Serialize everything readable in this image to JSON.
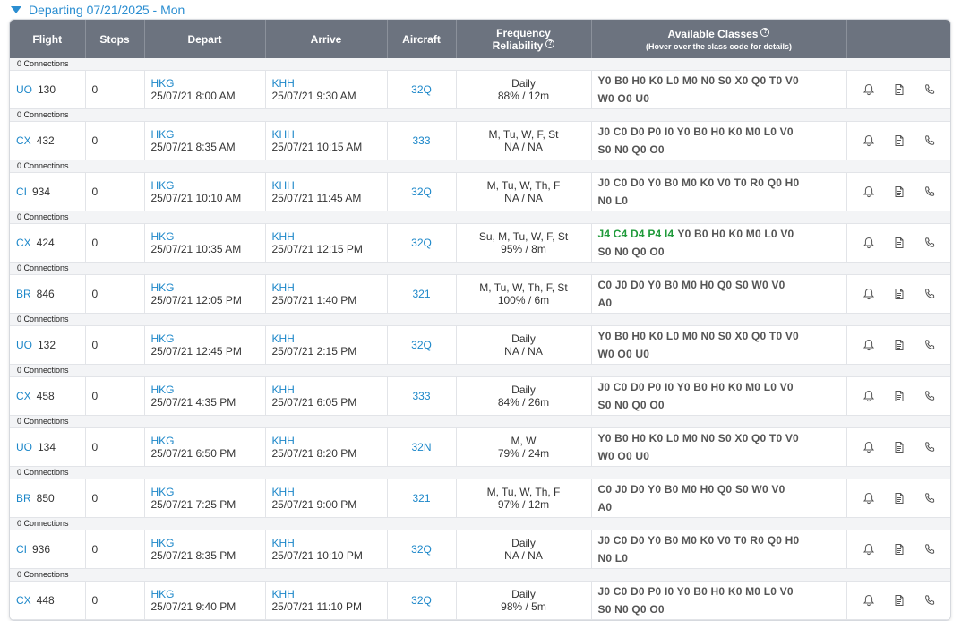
{
  "header": {
    "departing": "Departing 07/21/2025 - Mon"
  },
  "columns": {
    "flight": "Flight",
    "stops": "Stops",
    "depart": "Depart",
    "arrive": "Arrive",
    "aircraft": "Aircraft",
    "freq_line1": "Frequency",
    "freq_line2": "Reliability",
    "classes": "Available Classes",
    "classes_sub": "(Hover over the class code for details)"
  },
  "colors": {
    "header_bg": "#6c737f",
    "link": "#1c87c9",
    "highlight": "#1f9a3a"
  },
  "icons": [
    "bell-icon",
    "document-icon",
    "phone-icon"
  ],
  "flights": [
    {
      "connections": "0 Connections",
      "airline": "UO",
      "number": "130",
      "stops": "0",
      "dep_airport": "HKG",
      "dep_time": "25/07/21 8:00 AM",
      "arr_airport": "KHH",
      "arr_time": "25/07/21 9:30 AM",
      "aircraft": "32Q",
      "frequency": "Daily",
      "reliability": "88% / 12m",
      "classes_hl": "",
      "classes_line1": "Y0 B0 H0 K0 L0 M0 N0 S0 X0 Q0 T0 V0",
      "classes_line2": "W0 O0 U0"
    },
    {
      "connections": "0 Connections",
      "airline": "CX",
      "number": "432",
      "stops": "0",
      "dep_airport": "HKG",
      "dep_time": "25/07/21 8:35 AM",
      "arr_airport": "KHH",
      "arr_time": "25/07/21 10:15 AM",
      "aircraft": "333",
      "frequency": "M, Tu, W, F, St",
      "reliability": "NA / NA",
      "classes_hl": "",
      "classes_line1": "J0 C0 D0 P0 I0 Y0 B0 H0 K0 M0 L0 V0",
      "classes_line2": "S0 N0 Q0 O0"
    },
    {
      "connections": "0 Connections",
      "airline": "CI",
      "number": "934",
      "stops": "0",
      "dep_airport": "HKG",
      "dep_time": "25/07/21 10:10 AM",
      "arr_airport": "KHH",
      "arr_time": "25/07/21 11:45 AM",
      "aircraft": "32Q",
      "frequency": "M, Tu, W, Th, F",
      "reliability": "NA / NA",
      "classes_hl": "",
      "classes_line1": "J0 C0 D0 Y0 B0 M0 K0 V0 T0 R0 Q0 H0",
      "classes_line2": "N0 L0"
    },
    {
      "connections": "0 Connections",
      "airline": "CX",
      "number": "424",
      "stops": "0",
      "dep_airport": "HKG",
      "dep_time": "25/07/21 10:35 AM",
      "arr_airport": "KHH",
      "arr_time": "25/07/21 12:15 PM",
      "aircraft": "32Q",
      "frequency": "Su, M, Tu, W, F, St",
      "reliability": "95% / 8m",
      "classes_hl": "J4 C4 D4 P4 I4",
      "classes_line1": "Y0 B0 H0 K0 M0 L0 V0",
      "classes_line2": "S0 N0 Q0 O0"
    },
    {
      "connections": "0 Connections",
      "airline": "BR",
      "number": "846",
      "stops": "0",
      "dep_airport": "HKG",
      "dep_time": "25/07/21 12:05 PM",
      "arr_airport": "KHH",
      "arr_time": "25/07/21 1:40 PM",
      "aircraft": "321",
      "frequency": "M, Tu, W, Th, F, St",
      "reliability": "100% / 6m",
      "classes_hl": "",
      "classes_line1": "C0 J0 D0 Y0 B0 M0 H0 Q0 S0 W0 V0",
      "classes_line2": "A0"
    },
    {
      "connections": "0 Connections",
      "airline": "UO",
      "number": "132",
      "stops": "0",
      "dep_airport": "HKG",
      "dep_time": "25/07/21 12:45 PM",
      "arr_airport": "KHH",
      "arr_time": "25/07/21 2:15 PM",
      "aircraft": "32Q",
      "frequency": "Daily",
      "reliability": "NA / NA",
      "classes_hl": "",
      "classes_line1": "Y0 B0 H0 K0 L0 M0 N0 S0 X0 Q0 T0 V0",
      "classes_line2": "W0 O0 U0"
    },
    {
      "connections": "0 Connections",
      "airline": "CX",
      "number": "458",
      "stops": "0",
      "dep_airport": "HKG",
      "dep_time": "25/07/21 4:35 PM",
      "arr_airport": "KHH",
      "arr_time": "25/07/21 6:05 PM",
      "aircraft": "333",
      "frequency": "Daily",
      "reliability": "84% / 26m",
      "classes_hl": "",
      "classes_line1": "J0 C0 D0 P0 I0 Y0 B0 H0 K0 M0 L0 V0",
      "classes_line2": "S0 N0 Q0 O0"
    },
    {
      "connections": "0 Connections",
      "airline": "UO",
      "number": "134",
      "stops": "0",
      "dep_airport": "HKG",
      "dep_time": "25/07/21 6:50 PM",
      "arr_airport": "KHH",
      "arr_time": "25/07/21 8:20 PM",
      "aircraft": "32N",
      "frequency": "M, W",
      "reliability": "79% / 24m",
      "classes_hl": "",
      "classes_line1": "Y0 B0 H0 K0 L0 M0 N0 S0 X0 Q0 T0 V0",
      "classes_line2": "W0 O0 U0"
    },
    {
      "connections": "0 Connections",
      "airline": "BR",
      "number": "850",
      "stops": "0",
      "dep_airport": "HKG",
      "dep_time": "25/07/21 7:25 PM",
      "arr_airport": "KHH",
      "arr_time": "25/07/21 9:00 PM",
      "aircraft": "321",
      "frequency": "M, Tu, W, Th, F",
      "reliability": "97% / 12m",
      "classes_hl": "",
      "classes_line1": "C0 J0 D0 Y0 B0 M0 H0 Q0 S0 W0 V0",
      "classes_line2": "A0"
    },
    {
      "connections": "0 Connections",
      "airline": "CI",
      "number": "936",
      "stops": "0",
      "dep_airport": "HKG",
      "dep_time": "25/07/21 8:35 PM",
      "arr_airport": "KHH",
      "arr_time": "25/07/21 10:10 PM",
      "aircraft": "32Q",
      "frequency": "Daily",
      "reliability": "NA / NA",
      "classes_hl": "",
      "classes_line1": "J0 C0 D0 Y0 B0 M0 K0 V0 T0 R0 Q0 H0",
      "classes_line2": "N0 L0"
    },
    {
      "connections": "0 Connections",
      "airline": "CX",
      "number": "448",
      "stops": "0",
      "dep_airport": "HKG",
      "dep_time": "25/07/21 9:40 PM",
      "arr_airport": "KHH",
      "arr_time": "25/07/21 11:10 PM",
      "aircraft": "32Q",
      "frequency": "Daily",
      "reliability": "98% / 5m",
      "classes_hl": "",
      "classes_line1": "J0 C0 D0 P0 I0 Y0 B0 H0 K0 M0 L0 V0",
      "classes_line2": "S0 N0 Q0 O0"
    }
  ]
}
